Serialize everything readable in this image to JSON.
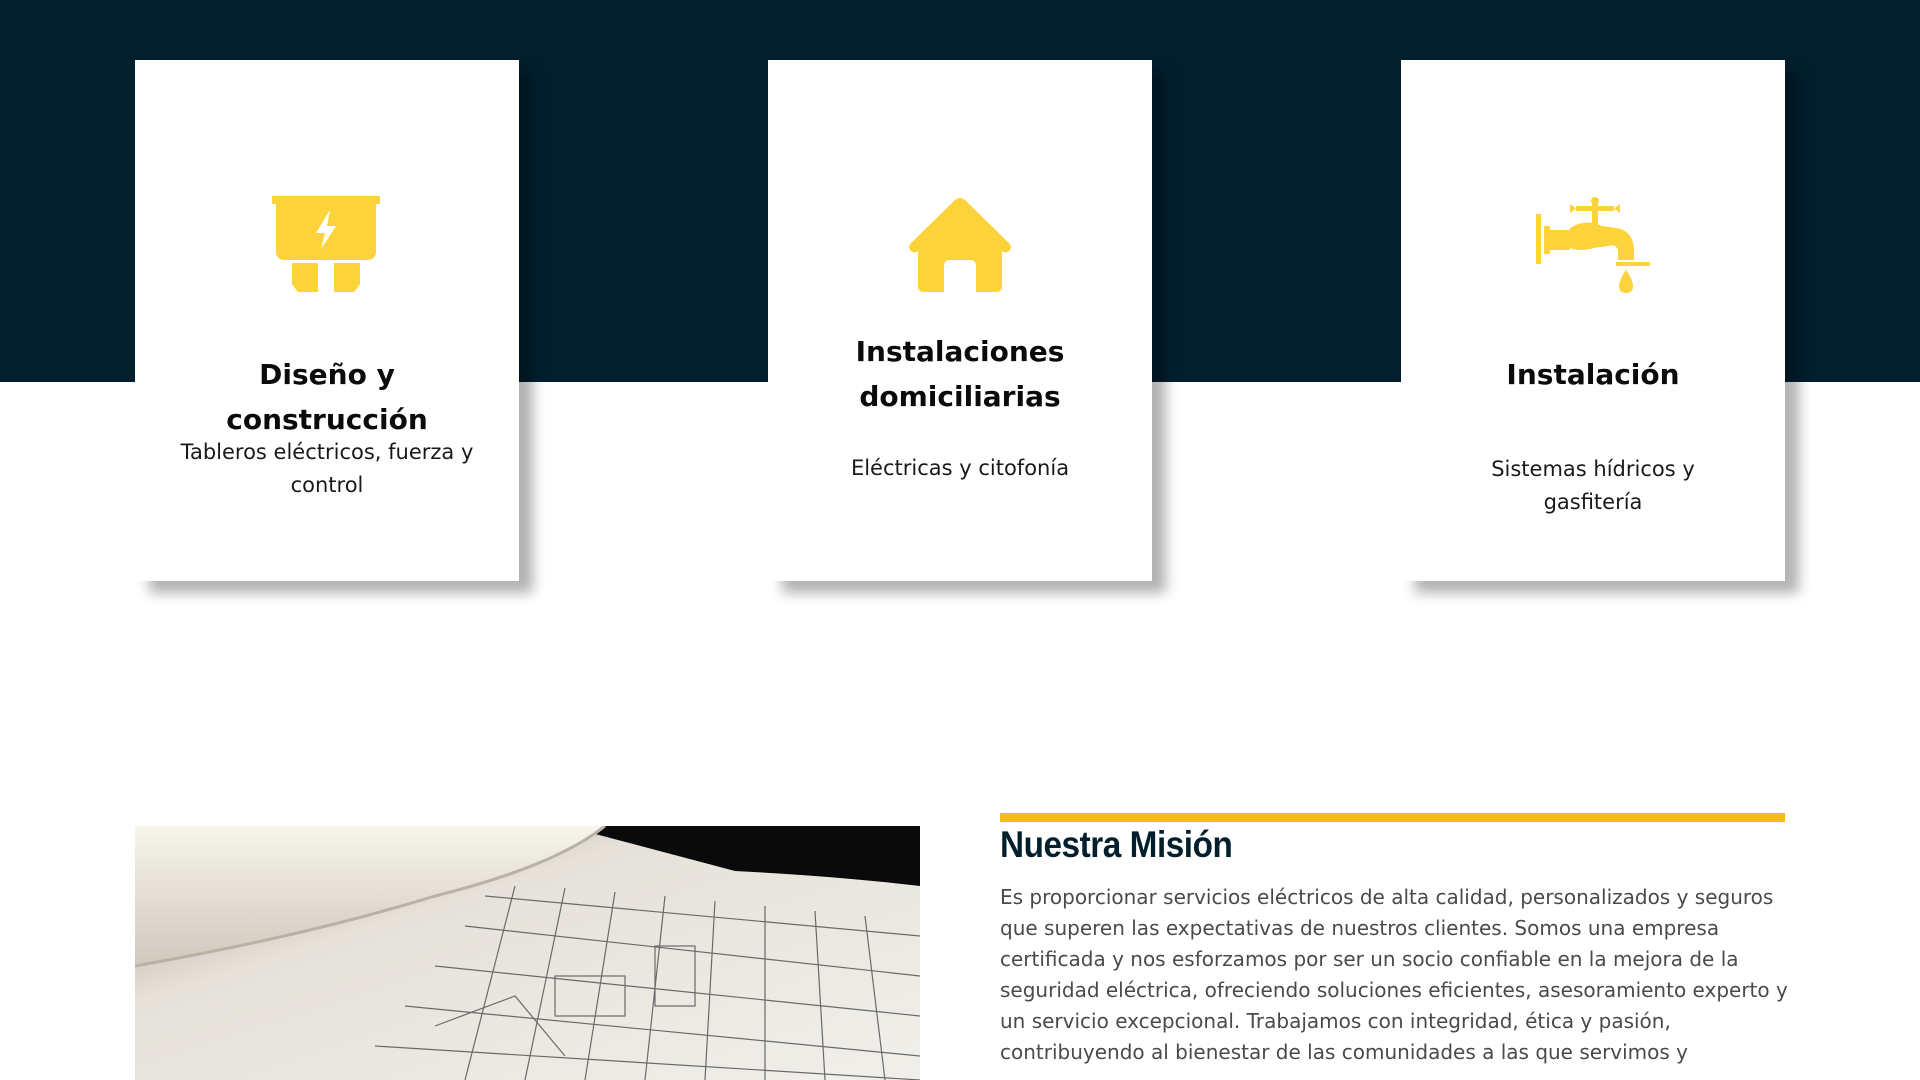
{
  "services": [
    {
      "icon": "fuse-lightning-icon",
      "title": "Diseño y construcción",
      "description": "Tableros eléctricos, fuerza y control"
    },
    {
      "icon": "house-icon",
      "title": "Instalaciones domiciliarias",
      "description": "Eléctricas y citofonía"
    },
    {
      "icon": "water-faucet-icon",
      "title": "Instalación",
      "description": "Sistemas hídricos y gasfitería"
    }
  ],
  "mission": {
    "title": "Nuestra Misión",
    "text": "Es proporcionar servicios eléctricos de alta calidad, personalizados y seguros que superen las expectativas de nuestros clientes. Somos una empresa certificada y nos esforzamos por ser un socio confiable en la mejora de la seguridad eléctrica, ofreciendo soluciones eficientes, asesoramiento experto y un servicio excepcional. Trabajamos con integridad, ética y pasión, contribuyendo al bienestar de las comunidades a las que servimos y"
  },
  "colors": {
    "navy": "#021f2e",
    "accent_yellow": "#f5bd0d",
    "icon_yellow": "#fdd33c"
  }
}
